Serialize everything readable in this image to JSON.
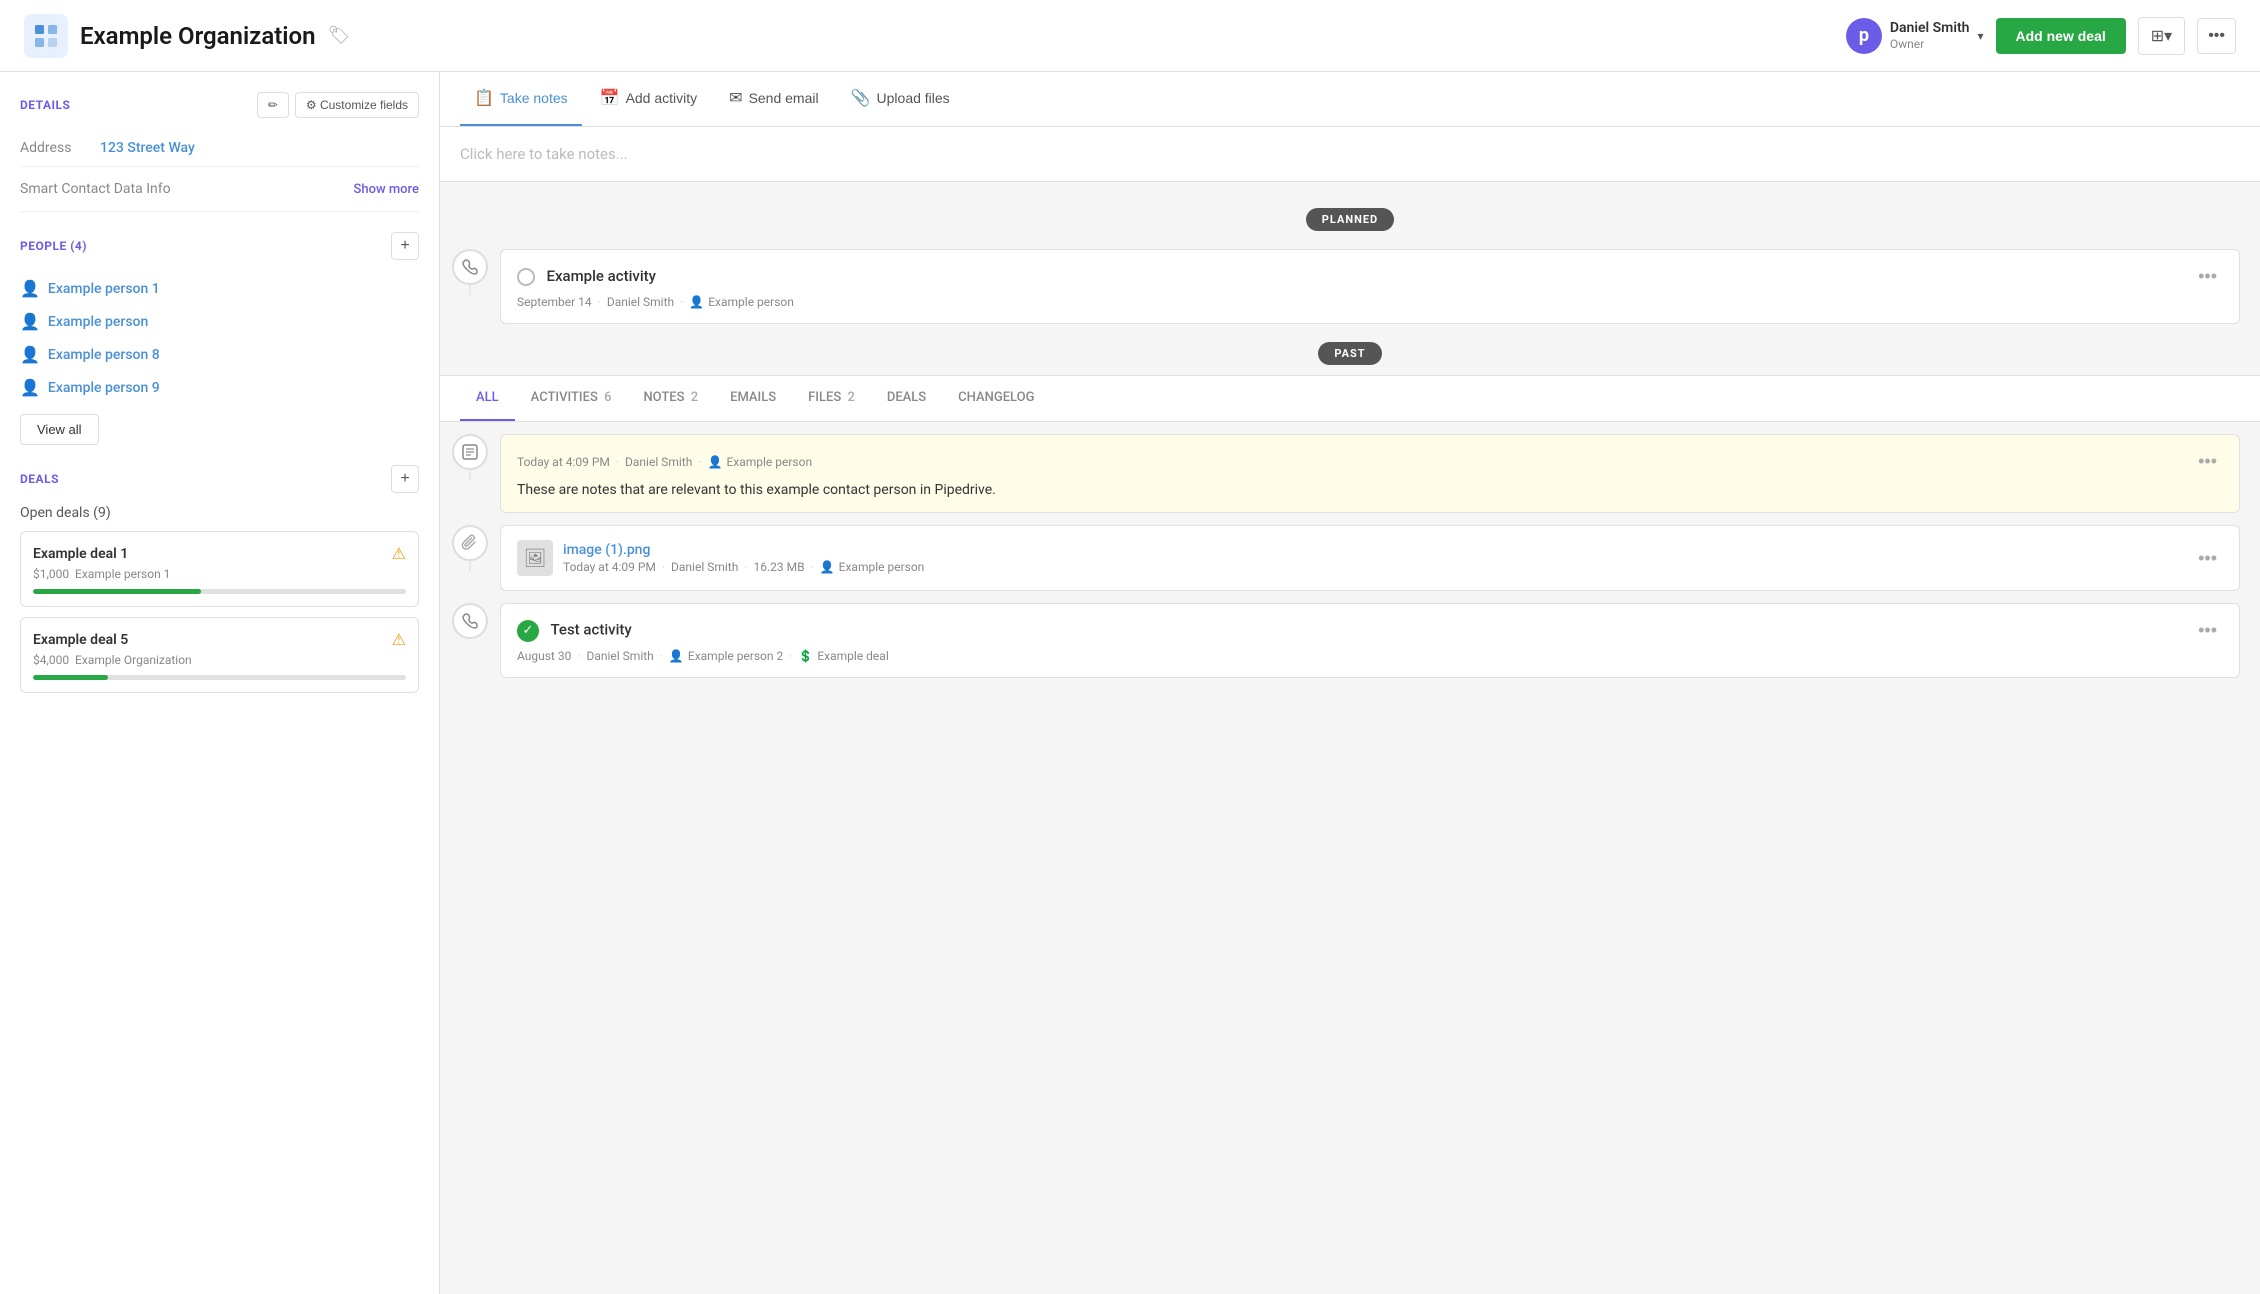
{
  "header": {
    "org_icon": "🏢",
    "org_title": "Example Organization",
    "user_initial": "p",
    "user_name": "Daniel Smith",
    "user_role": "Owner",
    "add_deal_label": "Add new deal",
    "grid_icon": "⊞",
    "more_icon": "•••"
  },
  "sidebar": {
    "details_title": "DETAILS",
    "edit_label": "✏",
    "customize_label": "⚙ Customize fields",
    "address_label": "Address",
    "address_value": "123 Street Way",
    "smart_contact_label": "Smart Contact Data Info",
    "show_more_label": "Show more",
    "people_title": "PEOPLE (4)",
    "people": [
      {
        "name": "Example person 1"
      },
      {
        "name": "Example person"
      },
      {
        "name": "Example person 8"
      },
      {
        "name": "Example person 9"
      }
    ],
    "view_all_label": "View all",
    "deals_title": "DEALS",
    "open_deals_label": "Open deals (9)",
    "deals": [
      {
        "name": "Example deal 1",
        "amount": "$1,000",
        "person": "Example person 1",
        "progress": 45
      },
      {
        "name": "Example deal 5",
        "amount": "$4,000",
        "person": "Example Organization",
        "progress": 20
      }
    ]
  },
  "toolbar": {
    "take_notes_label": "Take notes",
    "add_activity_label": "Add activity",
    "send_email_label": "Send email",
    "upload_files_label": "Upload files",
    "notes_placeholder": "Click here to take notes..."
  },
  "feed": {
    "planned_label": "PLANNED",
    "past_label": "PAST",
    "planned_activity": {
      "title": "Example activity",
      "date": "September 14",
      "user": "Daniel Smith",
      "person": "Example person"
    },
    "tabs": [
      {
        "label": "ALL",
        "count": "",
        "active": true
      },
      {
        "label": "ACTIVITIES",
        "count": "6",
        "active": false
      },
      {
        "label": "NOTES",
        "count": "2",
        "active": false
      },
      {
        "label": "EMAILS",
        "count": "",
        "active": false
      },
      {
        "label": "FILES",
        "count": "2",
        "active": false
      },
      {
        "label": "DEALS",
        "count": "",
        "active": false
      },
      {
        "label": "CHANGELOG",
        "count": "",
        "active": false
      }
    ],
    "note_item": {
      "timestamp": "Today at 4:09 PM",
      "user": "Daniel Smith",
      "person": "Example person",
      "text": "These are notes that are relevant to this example contact person in Pipedrive."
    },
    "file_item": {
      "filename": "image (1).png",
      "timestamp": "Today at 4:09 PM",
      "user": "Daniel Smith",
      "size": "16.23 MB",
      "person": "Example person"
    },
    "past_activity": {
      "title": "Test activity",
      "date": "August 30",
      "user": "Daniel Smith",
      "person2": "Example person 2",
      "deal": "Example deal"
    }
  }
}
